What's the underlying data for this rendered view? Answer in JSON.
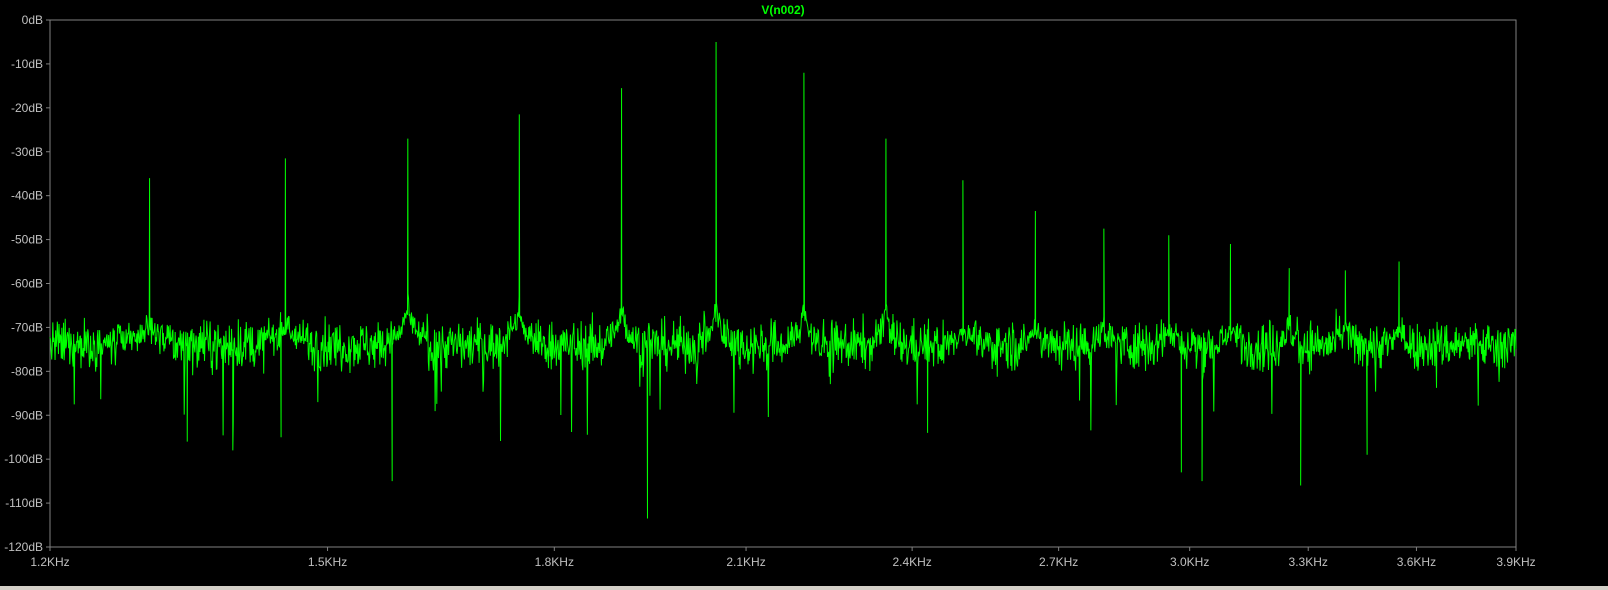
{
  "chart_data": {
    "type": "line",
    "title": "V(n002)",
    "xlabel": "",
    "ylabel": "",
    "xscale": "log",
    "xlim": [
      1200,
      3900
    ],
    "ylim": [
      -120,
      0
    ],
    "grid": false,
    "legend": "none",
    "trace_color": "#00ff00",
    "background": "#000000",
    "axis_color": "#808080",
    "label_color": "#c0c0c0",
    "noise_floor_db": -74,
    "noise_spread_db": 5,
    "xticks": [
      {
        "value": 1200,
        "label": "1.2KHz"
      },
      {
        "value": 1500,
        "label": "1.5KHz"
      },
      {
        "value": 1800,
        "label": "1.8KHz"
      },
      {
        "value": 2100,
        "label": "2.1KHz"
      },
      {
        "value": 2400,
        "label": "2.4KHz"
      },
      {
        "value": 2700,
        "label": "2.7KHz"
      },
      {
        "value": 3000,
        "label": "3.0KHz"
      },
      {
        "value": 3300,
        "label": "3.3KHz"
      },
      {
        "value": 3600,
        "label": "3.6KHz"
      },
      {
        "value": 3900,
        "label": "3.9KHz"
      }
    ],
    "yticks": [
      {
        "value": 0,
        "label": "0dB"
      },
      {
        "value": -10,
        "label": "-10dB"
      },
      {
        "value": -20,
        "label": "-20dB"
      },
      {
        "value": -30,
        "label": "-30dB"
      },
      {
        "value": -40,
        "label": "-40dB"
      },
      {
        "value": -50,
        "label": "-50dB"
      },
      {
        "value": -60,
        "label": "-60dB"
      },
      {
        "value": -70,
        "label": "-70dB"
      },
      {
        "value": -80,
        "label": "-80dB"
      },
      {
        "value": -90,
        "label": "-90dB"
      },
      {
        "value": -100,
        "label": "-100dB"
      },
      {
        "value": -110,
        "label": "-110dB"
      },
      {
        "value": -120,
        "label": "-120dB"
      }
    ],
    "peaks": [
      {
        "x": 1300,
        "y": -36
      },
      {
        "x": 1450,
        "y": -31.5
      },
      {
        "x": 1600,
        "y": -27
      },
      {
        "x": 1750,
        "y": -21.5
      },
      {
        "x": 1900,
        "y": -15.5
      },
      {
        "x": 2050,
        "y": -5
      },
      {
        "x": 2200,
        "y": -12
      },
      {
        "x": 2350,
        "y": -27
      },
      {
        "x": 2500,
        "y": -36.5
      },
      {
        "x": 2650,
        "y": -43.5
      },
      {
        "x": 2800,
        "y": -47.5
      },
      {
        "x": 2950,
        "y": -49
      },
      {
        "x": 3100,
        "y": -51
      },
      {
        "x": 3250,
        "y": -56.5
      },
      {
        "x": 3400,
        "y": -57
      },
      {
        "x": 3550,
        "y": -55
      }
    ],
    "dips": [
      {
        "x": 1340,
        "y": -96
      },
      {
        "x": 1390,
        "y": -98
      },
      {
        "x": 1445,
        "y": -95
      },
      {
        "x": 1580,
        "y": -105
      },
      {
        "x": 1940,
        "y": -113.5
      },
      {
        "x": 2430,
        "y": -94
      },
      {
        "x": 2980,
        "y": -103
      },
      {
        "x": 3030,
        "y": -105
      },
      {
        "x": 3280,
        "y": -106
      },
      {
        "x": 3460,
        "y": -99
      }
    ]
  }
}
